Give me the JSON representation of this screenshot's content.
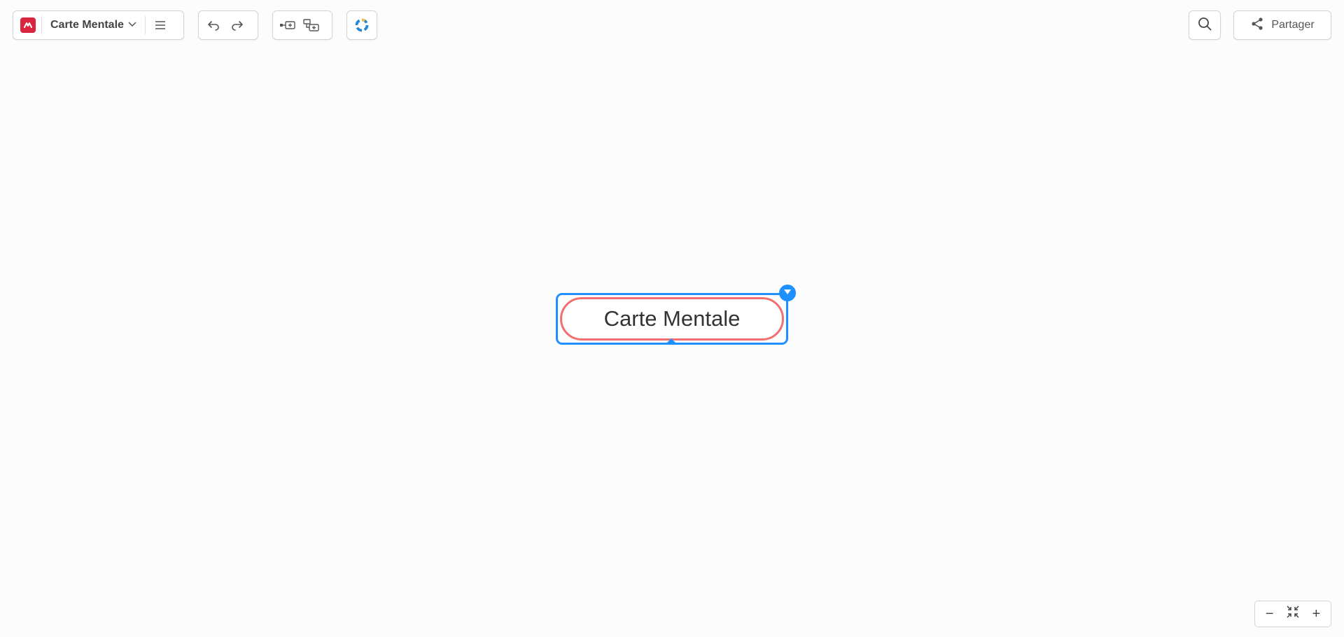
{
  "toolbar": {
    "title": "Carte Mentale",
    "logo_icon": "app-logo-icon",
    "title_dropdown_icon": "chevron-down-icon",
    "menu_icon": "hamburger-menu-icon",
    "undo_icon": "undo-icon",
    "redo_icon": "redo-icon",
    "add_sibling_icon": "add-sibling-node-icon",
    "add_child_icon": "add-child-node-icon",
    "theme_icon": "color-theme-icon",
    "search_icon": "search-icon",
    "share_icon": "share-icon",
    "share_label": "Partager"
  },
  "canvas": {
    "root_node": {
      "label": "Carte Mentale",
      "border_color": "#f07070",
      "selection_color": "#1e90ff"
    }
  },
  "zoom": {
    "zoom_out_label": "−",
    "zoom_in_label": "+",
    "fit_icon": "fit-to-screen-icon"
  },
  "colors": {
    "background": "#fcfcfc",
    "brand": "#d7263d",
    "accent": "#1e90ff"
  }
}
